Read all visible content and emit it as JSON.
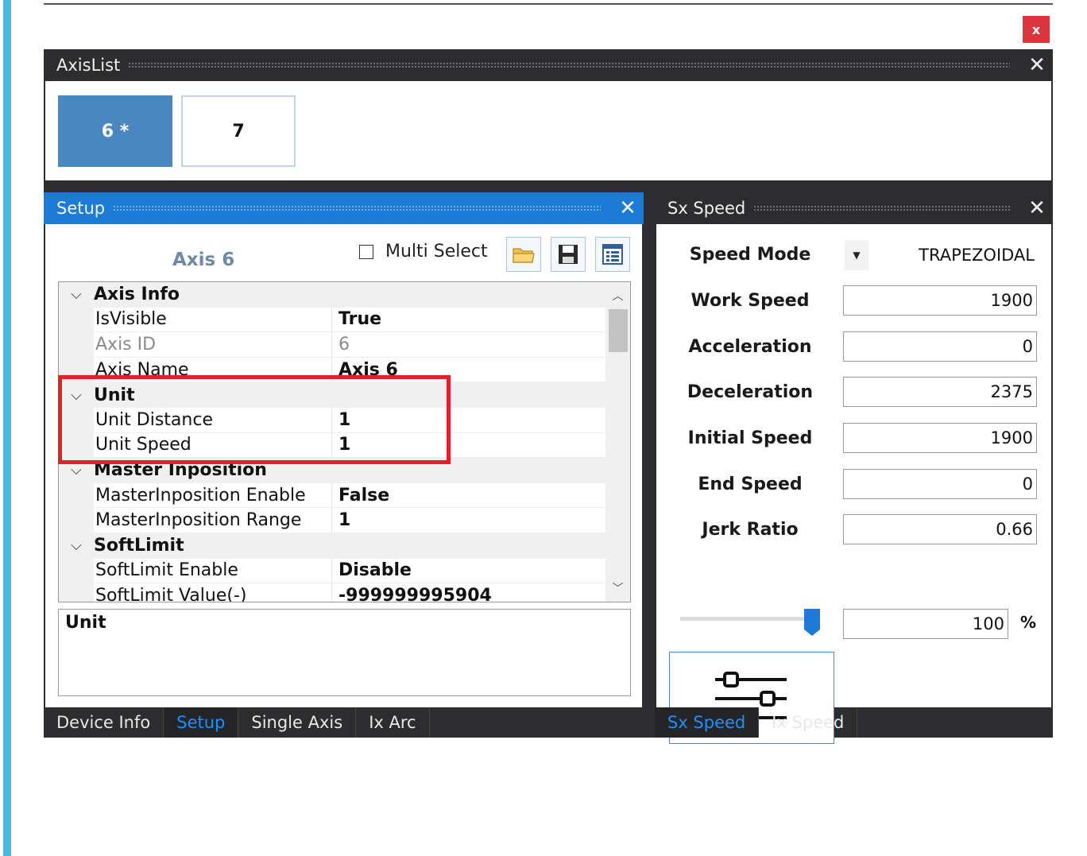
{
  "window": {
    "close_label": "x"
  },
  "axislist": {
    "title": "AxisList",
    "close": "✕",
    "axes": [
      {
        "label": "6 *",
        "active": true
      },
      {
        "label": "7",
        "active": false
      }
    ]
  },
  "setup": {
    "title": "Setup",
    "close": "✕",
    "axis_title": "Axis 6",
    "multi_select_label": "Multi Select",
    "toolbar": {
      "open": "folder-open-icon",
      "save": "save-icon",
      "list": "list-icon"
    },
    "rows": [
      {
        "kind": "cat",
        "label": "Axis Info"
      },
      {
        "kind": "prop",
        "name": "IsVisible",
        "value": "True"
      },
      {
        "kind": "prop",
        "name": "Axis ID",
        "value": "6",
        "dim": true
      },
      {
        "kind": "prop",
        "name": "Axis Name",
        "value": "Axis 6"
      },
      {
        "kind": "cat",
        "label": "Unit"
      },
      {
        "kind": "prop",
        "name": "Unit Distance",
        "value": "1"
      },
      {
        "kind": "prop",
        "name": "Unit Speed",
        "value": "1"
      },
      {
        "kind": "cat",
        "label": "Master Inposition"
      },
      {
        "kind": "prop",
        "name": "MasterInposition Enable",
        "value": "False"
      },
      {
        "kind": "prop",
        "name": "MasterInposition Range",
        "value": "1"
      },
      {
        "kind": "cat",
        "label": "SoftLimit"
      },
      {
        "kind": "prop",
        "name": "SoftLimit Enable",
        "value": "Disable"
      },
      {
        "kind": "prop",
        "name": "SoftLimit Value(-)",
        "value": "-999999995904"
      }
    ],
    "description_title": "Unit"
  },
  "speed": {
    "title": "Sx Speed",
    "close": "✕",
    "speed_mode_label": "Speed Mode",
    "speed_mode_value": "TRAPEZOIDAL",
    "fields": [
      {
        "label": "Work Speed",
        "value": "1900"
      },
      {
        "label": "Acceleration",
        "value": "0"
      },
      {
        "label": "Deceleration",
        "value": "2375"
      },
      {
        "label": "Initial Speed",
        "value": "1900"
      },
      {
        "label": "End Speed",
        "value": "0"
      },
      {
        "label": "Jerk Ratio",
        "value": "0.66"
      }
    ],
    "override_value": "100",
    "override_unit": "%",
    "slider_fraction": 0.95,
    "apply_icon": "sliders-icon"
  },
  "tabs_left": [
    {
      "label": "Device Info",
      "active": false
    },
    {
      "label": "Setup",
      "active": true
    },
    {
      "label": "Single Axis",
      "active": false
    },
    {
      "label": "Ix Arc",
      "active": false
    }
  ],
  "tabs_right": [
    {
      "label": "Sx Speed",
      "active": true
    },
    {
      "label": "Ix Speed",
      "active": false
    }
  ],
  "colors": {
    "accent": "#1c7bd4",
    "highlight": "#e0202a",
    "active_axis": "#4a86bf"
  }
}
